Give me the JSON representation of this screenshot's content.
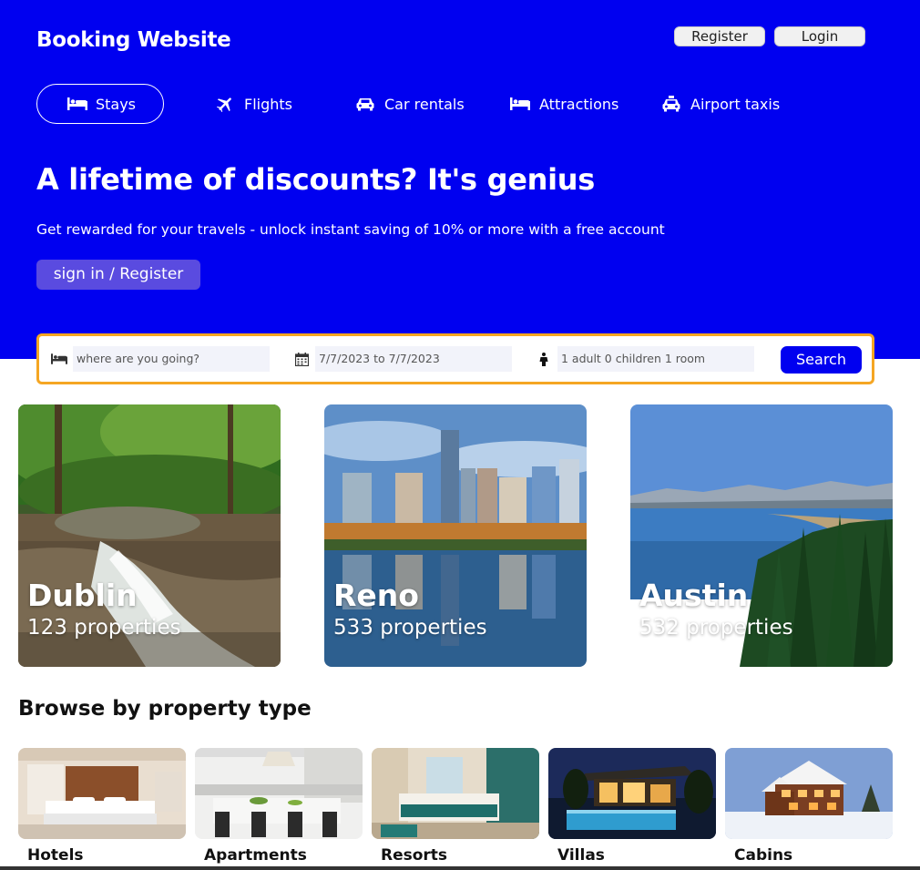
{
  "header": {
    "brand": "Booking Website",
    "register_label": "Register",
    "login_label": "Login",
    "nav": [
      {
        "label": "Stays",
        "icon": "bed-icon",
        "active": true
      },
      {
        "label": "Flights",
        "icon": "plane-icon"
      },
      {
        "label": "Car rentals",
        "icon": "car-icon"
      },
      {
        "label": "Attractions",
        "icon": "bed-icon"
      },
      {
        "label": "Airport taxis",
        "icon": "taxi-icon"
      }
    ],
    "hero_title": "A lifetime of discounts? It's genius",
    "hero_subtitle": "Get rewarded for your travels - unlock instant saving of 10% or more with a free account",
    "hero_button": "sign in / Register"
  },
  "search": {
    "destination_placeholder": "where are you going?",
    "dates": "7/7/2023 to 7/7/2023",
    "guests": "1 adult 0 children 1 room",
    "button": "Search"
  },
  "featured": [
    {
      "city": "Dublin",
      "properties": "123 properties"
    },
    {
      "city": "Reno",
      "properties": "533 properties"
    },
    {
      "city": "Austin",
      "properties": "532 properties"
    }
  ],
  "property_types": {
    "title": "Browse by property type",
    "items": [
      {
        "name": "Hotels"
      },
      {
        "name": "Apartments"
      },
      {
        "name": "Resorts"
      },
      {
        "name": "Villas"
      },
      {
        "name": "Cabins"
      }
    ]
  },
  "colors": {
    "header_bg": "#0000f0",
    "hero_button": "#5a4be0",
    "search_border": "#f5a623",
    "search_button": "#0000f0"
  }
}
